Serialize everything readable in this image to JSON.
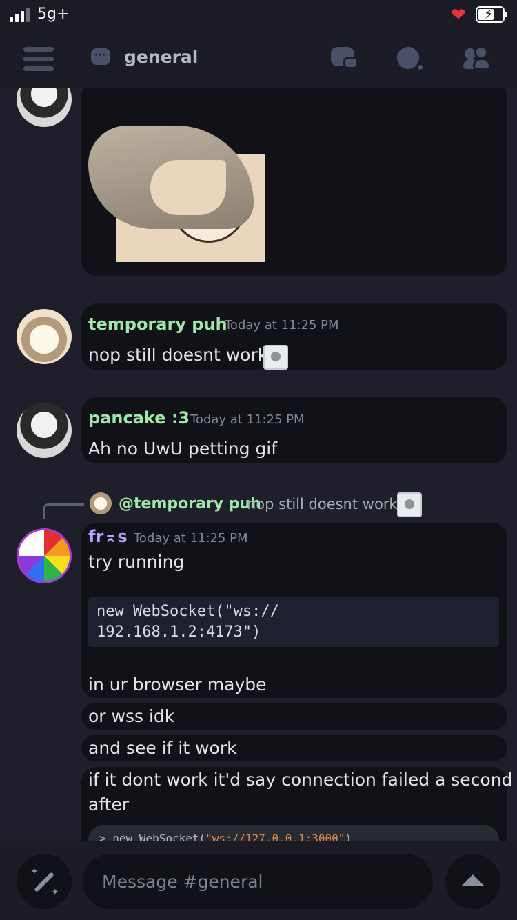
{
  "status_bar": {
    "network": "5g+"
  },
  "header": {
    "channel_name": "general"
  },
  "messages": [
    {
      "username": "temporary puh",
      "username_color": "#9ee8a8",
      "timestamp": "Today at 11:25 PM",
      "text": "nop still doesnt work"
    },
    {
      "username": "pancake :3",
      "username_color": "#9ee8a8",
      "timestamp": "Today at 11:25 PM",
      "text": "Ah no UwU petting gif"
    },
    {
      "reply": {
        "username": "@temporary puh",
        "text": "nop still doesnt work"
      },
      "username": "fr⌅s",
      "username_color": "#b3a6ff",
      "timestamp": "Today at 11:25 PM",
      "text": "try running",
      "code_lines": [
        "new WebSocket(\"ws://",
        "192.168.1.2:4173\")"
      ],
      "after_text": "in ur browser maybe"
    }
  ],
  "followups": [
    "or wss idk",
    "and see if it work",
    "if it dont work it'd say connection failed a second",
    "after"
  ],
  "embed_code": {
    "prefix": "> new WebSocket(",
    "string": "\"ws://127.0.0.1:3000\"",
    "suffix": ")"
  },
  "composer": {
    "placeholder": "Message #general"
  },
  "colors": {
    "background": "#1e1f2b",
    "bubble": "#111218",
    "accent_green": "#9ee8a8",
    "accent_purple": "#b3a6ff"
  }
}
